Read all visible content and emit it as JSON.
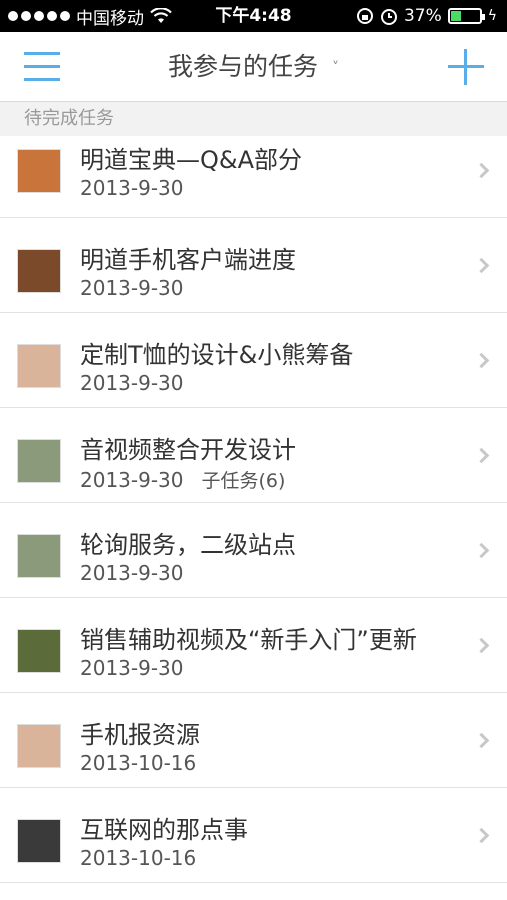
{
  "status_bar": {
    "carrier": "中国移动",
    "time": "下午4:48",
    "battery": "37%",
    "battery_level": 0.37
  },
  "navbar": {
    "title": "我参与的任务",
    "title_chevron": "˅"
  },
  "section": {
    "label": "待完成任务"
  },
  "tasks": [
    {
      "title": "明道宝典—Q&A部分",
      "date": "2013-9-30",
      "subtask": "",
      "avatar_color": "#c8743a"
    },
    {
      "title": "明道手机客户端进度",
      "date": "2013-9-30",
      "subtask": "",
      "avatar_color": "#7a4a2a"
    },
    {
      "title": "定制T恤的设计&小熊筹备",
      "date": "2013-9-30",
      "subtask": "",
      "avatar_color": "#d9b39a"
    },
    {
      "title": "音视频整合开发设计",
      "date": "2013-9-30",
      "subtask": "子任务(6)",
      "avatar_color": "#8a9a7a"
    },
    {
      "title": "轮询服务，二级站点",
      "date": "2013-9-30",
      "subtask": "",
      "avatar_color": "#8a9a7a"
    },
    {
      "title": "销售辅助视频及“新手入门”更新",
      "date": "2013-9-30",
      "subtask": "",
      "avatar_color": "#5b6b3a"
    },
    {
      "title": "手机报资源",
      "date": "2013-10-16",
      "subtask": "",
      "avatar_color": "#d9b39a"
    },
    {
      "title": "互联网的那点事",
      "date": "2013-10-16",
      "subtask": "",
      "avatar_color": "#3a3a3a"
    }
  ],
  "colors": {
    "accent": "#5aaee8",
    "status_bar_bg": "#000000",
    "battery_fill": "#4cd964"
  }
}
